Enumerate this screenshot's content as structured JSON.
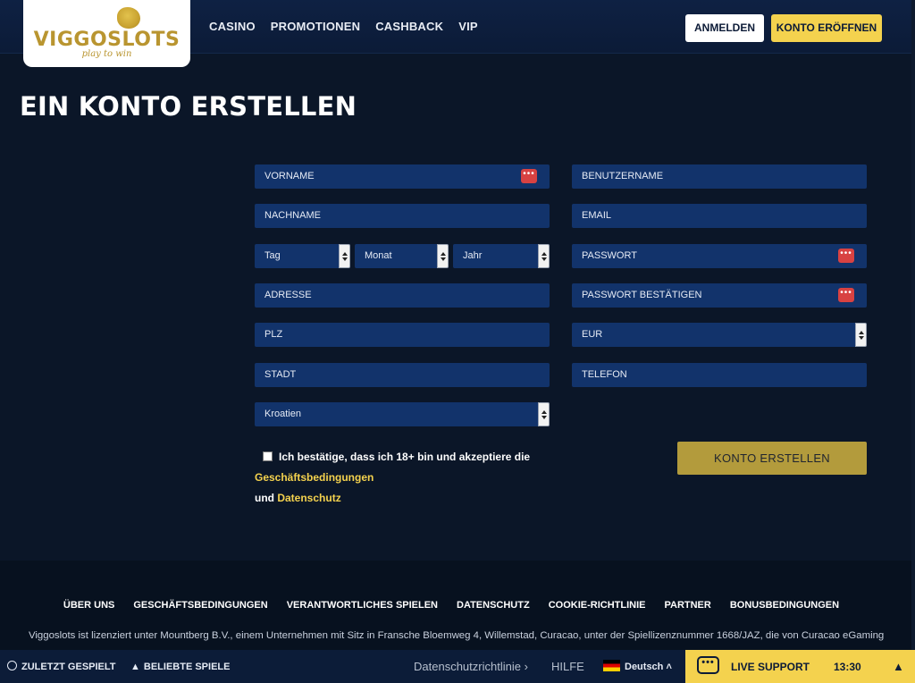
{
  "header": {
    "logo_text": "VIGGOSLOTS",
    "logo_tagline": "play to win",
    "nav": [
      "CASINO",
      "PROMOTIONEN",
      "CASHBACK",
      "VIP"
    ],
    "login_label": "ANMELDEN",
    "register_label": "KONTO ERÖFFNEN"
  },
  "page_title": "EIN KONTO ERSTELLEN",
  "form": {
    "first_name": "VORNAME",
    "last_name": "NACHNAME",
    "day": "Tag",
    "month": "Monat",
    "year": "Jahr",
    "address": "ADRESSE",
    "zip": "PLZ",
    "city": "STADT",
    "country": "Kroatien",
    "username": "BENUTZERNAME",
    "email": "EMAIL",
    "password": "PASSWORT",
    "password_confirm": "PASSWORT BESTÄTIGEN",
    "currency": "EUR",
    "phone": "TELEFON",
    "terms_prefix": "Ich bestätige, dass ich 18+ bin und akzeptiere die",
    "terms_link": "Geschäftsbedingungen",
    "terms_and": "und",
    "privacy_link": "Datenschutz",
    "submit_label": "KONTO ERSTELLEN"
  },
  "footer": {
    "links": [
      "ÜBER UNS",
      "GESCHÄFTSBEDINGUNGEN",
      "VERANTWORTLICHES SPIELEN",
      "DATENSCHUTZ",
      "COOKIE-RICHTLINIE",
      "PARTNER",
      "BONUSBEDINGUNGEN"
    ],
    "license": "Viggoslots ist lizenziert unter Mountberg B.V., einem Unternehmen mit Sitz in Fransche Bloemweg 4, Willemstad, Curacao, unter der Spiellizenznummer 1668/JAZ, die von Curacao eGaming"
  },
  "bottom_bar": {
    "recent": "ZULETZT GESPIELT",
    "popular": "BELIEBTE SPIELE",
    "privacy_policy": "Datenschutzrichtlinie",
    "help": "HILFE",
    "language": "Deutsch",
    "live_support": "LIVE SUPPORT",
    "time": "13:30"
  },
  "colors": {
    "accent": "#f4d24e",
    "field_bg": "#12336b",
    "page_bg": "#0b1628",
    "submit_bg": "#b39b3c"
  }
}
